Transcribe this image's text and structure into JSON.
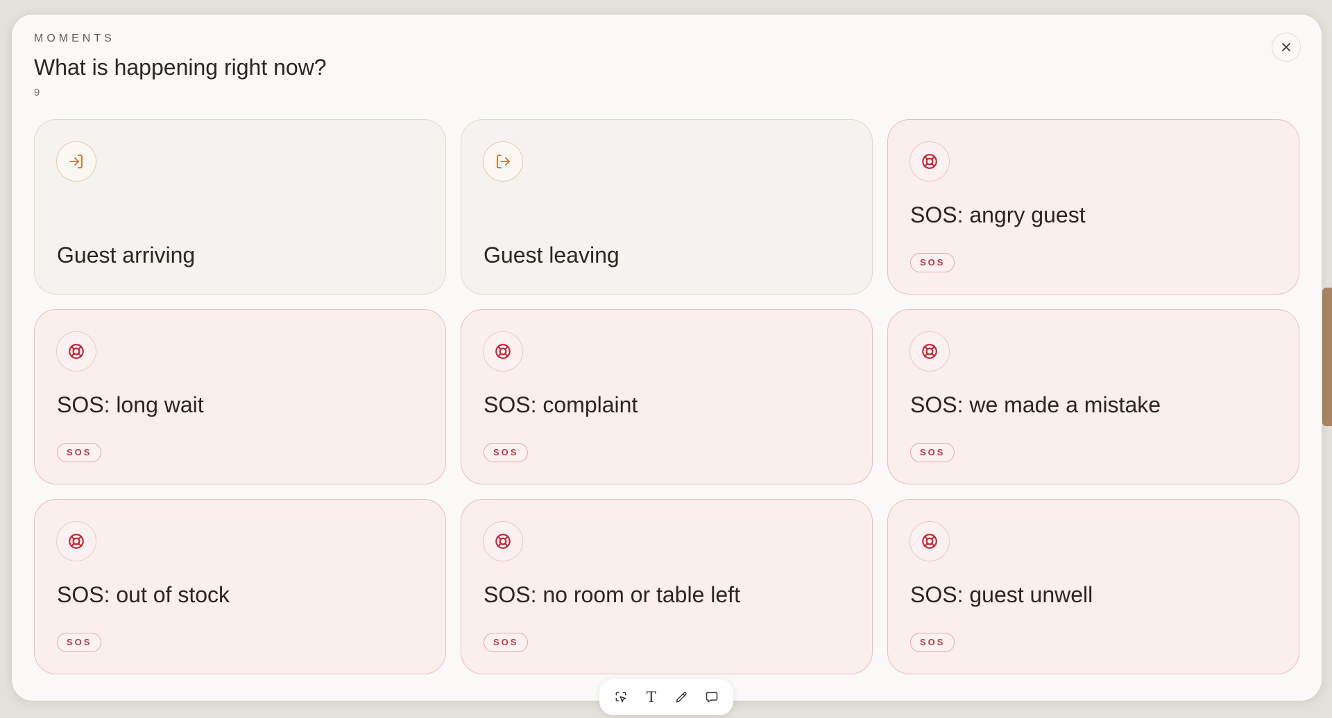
{
  "modal": {
    "eyebrow": "MOMENTS",
    "title": "What is happening right now?",
    "count": "9",
    "close_icon": "close-icon"
  },
  "colors": {
    "neutral_accent": "#d9691f",
    "sos_accent": "#c2283a",
    "sos_card_bg": "#faefec",
    "neutral_card_bg": "#f5f3f0"
  },
  "cards": [
    {
      "label": "Guest arriving",
      "kind": "neutral",
      "icon": "log-in-icon"
    },
    {
      "label": "Guest leaving",
      "kind": "neutral",
      "icon": "log-out-icon"
    },
    {
      "label": "SOS: angry guest",
      "kind": "sos",
      "icon": "lifebuoy-icon",
      "badge": "SOS"
    },
    {
      "label": "SOS: long wait",
      "kind": "sos",
      "icon": "lifebuoy-icon",
      "badge": "SOS"
    },
    {
      "label": "SOS: complaint",
      "kind": "sos",
      "icon": "lifebuoy-icon",
      "badge": "SOS"
    },
    {
      "label": "SOS: we made a mistake",
      "kind": "sos",
      "icon": "lifebuoy-icon",
      "badge": "SOS"
    },
    {
      "label": "SOS: out of stock",
      "kind": "sos",
      "icon": "lifebuoy-icon",
      "badge": "SOS"
    },
    {
      "label": "SOS: no room or table left",
      "kind": "sos",
      "icon": "lifebuoy-icon",
      "badge": "SOS"
    },
    {
      "label": "SOS: guest unwell",
      "kind": "sos",
      "icon": "lifebuoy-icon",
      "badge": "SOS"
    }
  ],
  "toolbar": {
    "tools": [
      {
        "icon": "select-element-icon"
      },
      {
        "icon": "text-icon",
        "glyph": "T"
      },
      {
        "icon": "pencil-icon"
      },
      {
        "icon": "comment-icon"
      }
    ]
  }
}
